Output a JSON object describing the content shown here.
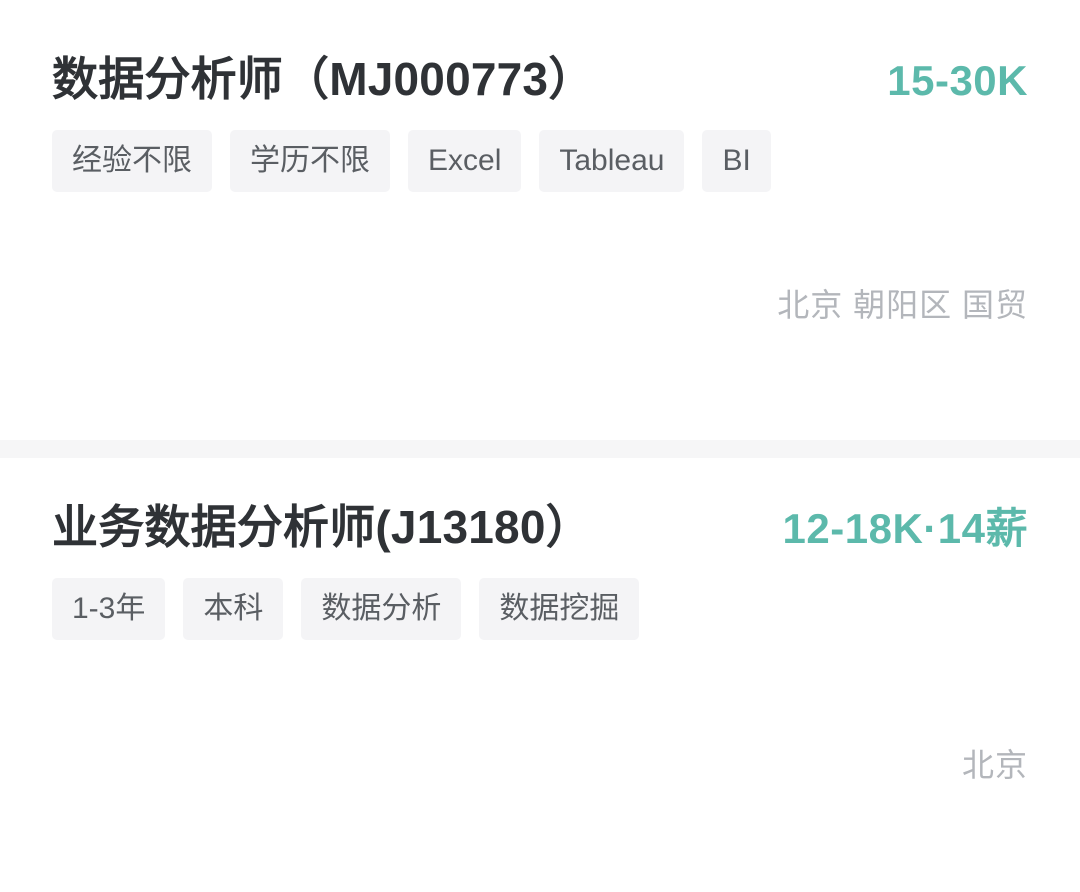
{
  "theme": {
    "page_background": "#ffffff",
    "accent_salary": "#5cb9ab",
    "title_color": "#2f3236",
    "tag_background": "#f4f4f6",
    "tag_text": "#5a5e63",
    "location_text": "#b3b6bb",
    "divider": "#f6f6f7"
  },
  "jobs": [
    {
      "title": "数据分析师（MJ000773）",
      "salary": "15-30K",
      "tags": [
        "经验不限",
        "学历不限",
        "Excel",
        "Tableau",
        "BI"
      ],
      "location": "北京 朝阳区 国贸"
    },
    {
      "title": "业务数据分析师(J13180）",
      "salary": "12-18K·14薪",
      "tags": [
        "1-3年",
        "本科",
        "数据分析",
        "数据挖掘"
      ],
      "location": "北京"
    }
  ]
}
